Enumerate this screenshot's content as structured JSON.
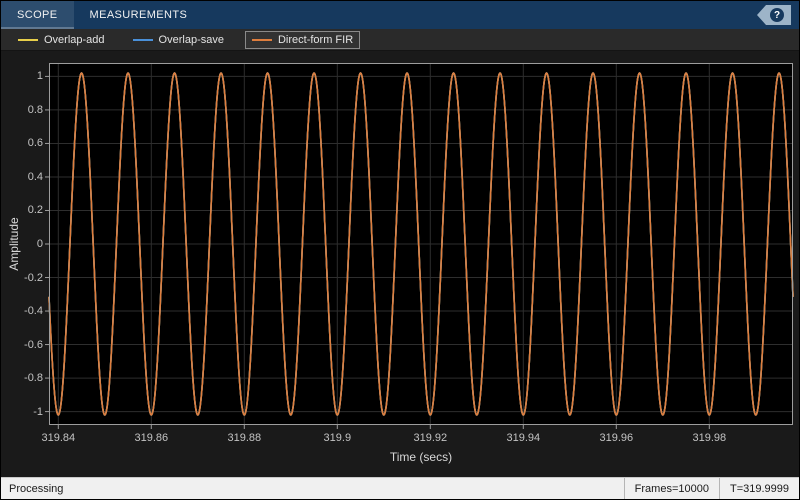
{
  "toolbar": {
    "tabs": [
      {
        "label": "SCOPE",
        "active": true
      },
      {
        "label": "MEASUREMENTS",
        "active": false
      }
    ],
    "help_label": "?"
  },
  "legend": {
    "items": [
      {
        "label": "Overlap-add",
        "color": "#e8cf4a",
        "selected": false
      },
      {
        "label": "Overlap-save",
        "color": "#4a90d9",
        "selected": false
      },
      {
        "label": "Direct-form FIR",
        "color": "#de7e3e",
        "selected": true
      }
    ]
  },
  "chart_data": {
    "type": "line",
    "title": "",
    "xlabel": "Time (secs)",
    "ylabel": "Amplitude",
    "xlim": [
      319.838,
      319.998
    ],
    "ylim": [
      -1.08,
      1.08
    ],
    "x_ticks": [
      319.84,
      319.86,
      319.88,
      319.9,
      319.92,
      319.94,
      319.96,
      319.98
    ],
    "x_tick_labels": [
      "319.84",
      "319.86",
      "319.88",
      "319.9",
      "319.92",
      "319.94",
      "319.96",
      "319.98"
    ],
    "y_ticks": [
      -1,
      -0.8,
      -0.6,
      -0.4,
      -0.2,
      0,
      0.2,
      0.4,
      0.6,
      0.8,
      1
    ],
    "y_tick_labels": [
      "-1",
      "-0.8",
      "-0.6",
      "-0.4",
      "-0.2",
      "0",
      "0.2",
      "0.4",
      "0.6",
      "0.8",
      "1"
    ],
    "grid": true,
    "grid_color": "#2e2e2e",
    "axes_color": "#9d9d9d",
    "plot_background": "#000000",
    "signal": {
      "shape": "sine",
      "frequency_hz": 100,
      "amplitude": 1.02,
      "peak_time": 319.845
    },
    "series": [
      {
        "name": "Overlap-add",
        "color": "#e8cf4a"
      },
      {
        "name": "Overlap-save",
        "color": "#4a90d9"
      },
      {
        "name": "Direct-form FIR",
        "color": "#de7e3e"
      }
    ],
    "legend_position": "top-left"
  },
  "status_bar": {
    "processing": "Processing",
    "frames": "Frames=10000",
    "time": "T=319.9999"
  }
}
